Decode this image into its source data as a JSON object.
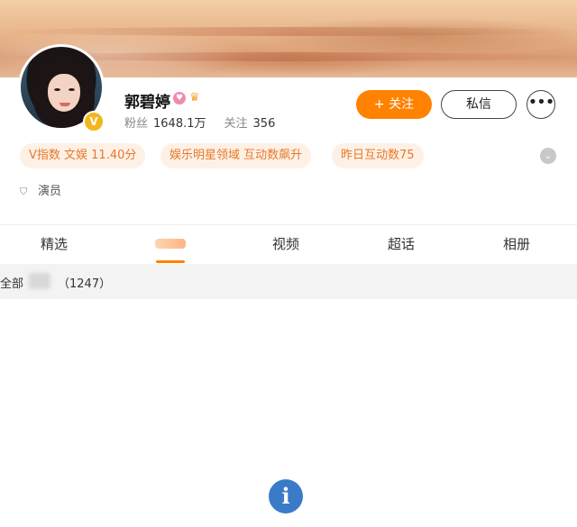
{
  "profile": {
    "name": "郭碧婷",
    "verified_badge": "V",
    "fans_label": "粉丝",
    "fans_value": "1648.1万",
    "following_label": "关注",
    "following_value": "356",
    "follow_button": "+ 关注",
    "message_button": "私信",
    "more_button": "•••",
    "role": "演员"
  },
  "tags": [
    {
      "label": "V指数 文娱 11.40分"
    },
    {
      "label": "娱乐明星领域 互动数飙升"
    },
    {
      "label": "昨日互动数75"
    }
  ],
  "tabs": [
    {
      "label": "精选"
    },
    {
      "label": "视频"
    },
    {
      "label": "超话"
    },
    {
      "label": "相册"
    }
  ],
  "filter": {
    "all_label": "全部",
    "count": "（1247）"
  },
  "icons": {
    "info": "info-icon",
    "expand": "chevron-down-icon",
    "shield": "shield-icon",
    "crown": "crown-icon"
  },
  "colors": {
    "accent": "#ff8200",
    "tag_text": "#e8782a",
    "tag_bg": "#fdf1e6",
    "verified": "#f4b71b"
  }
}
